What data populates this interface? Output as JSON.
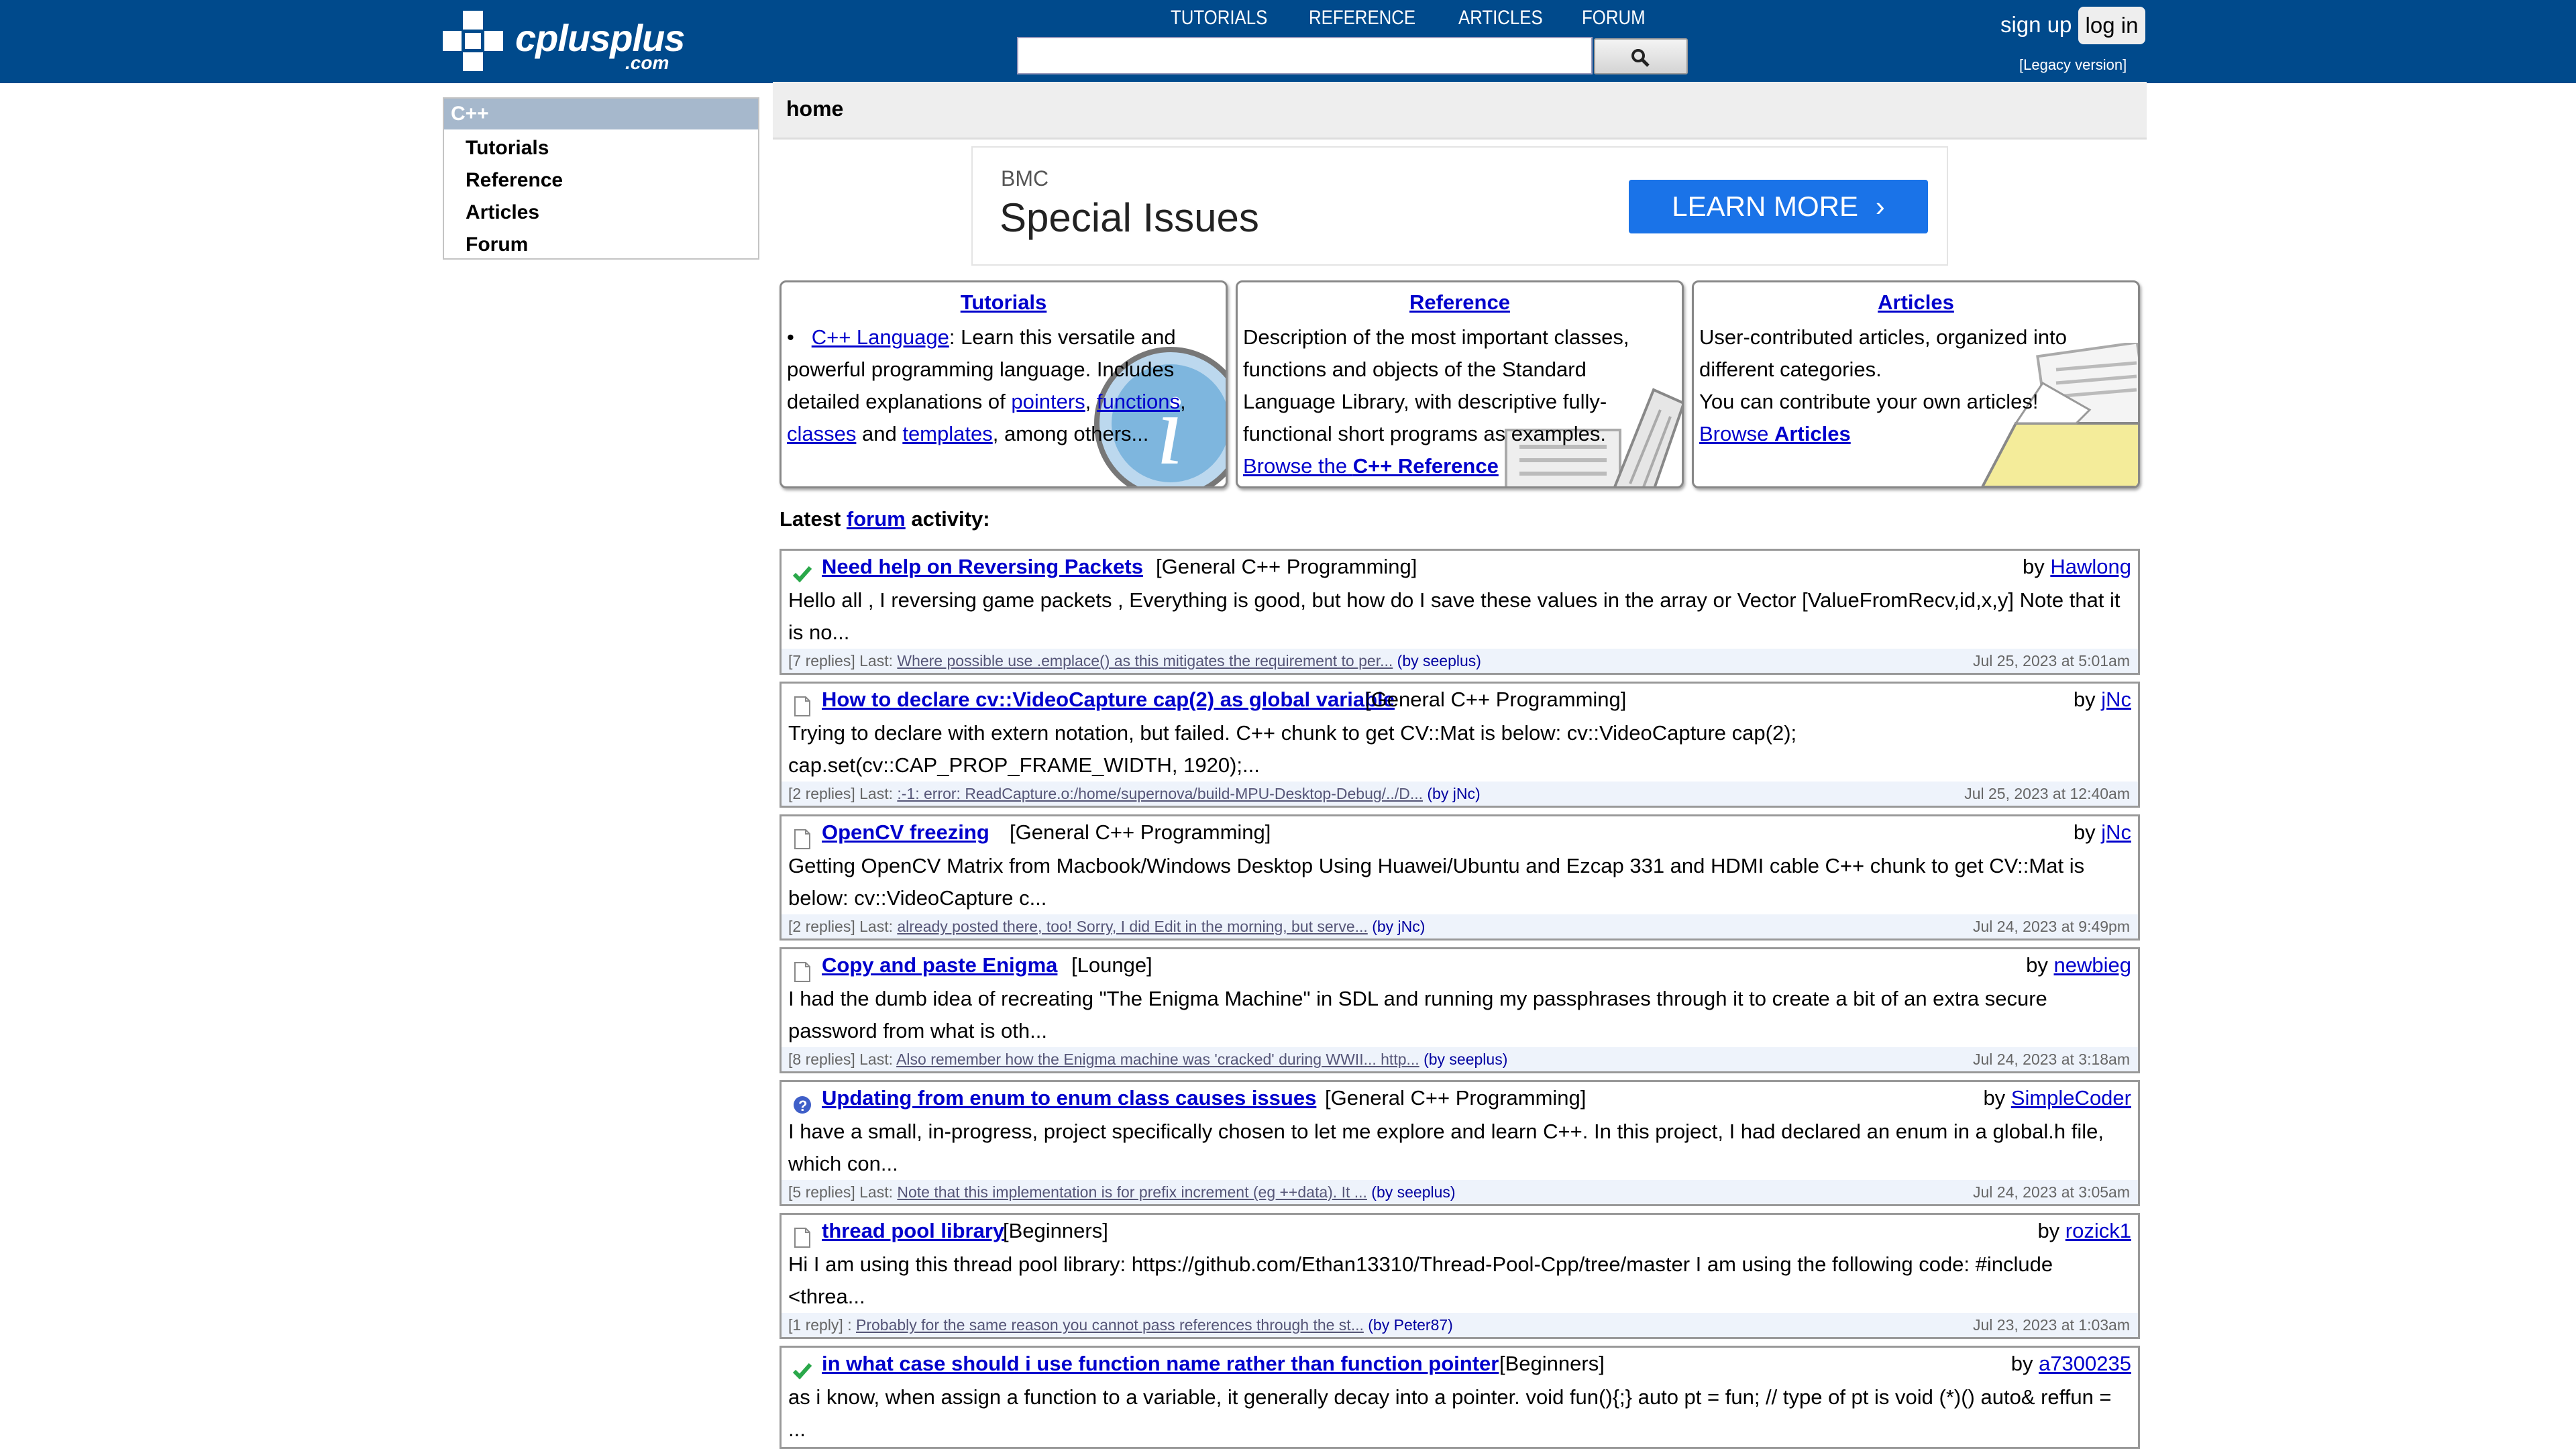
{
  "header": {
    "logo_word": "cplusplus",
    "logo_domain": ".com",
    "nav": [
      "TUTORIALS",
      "REFERENCE",
      "ARTICLES",
      "FORUM"
    ],
    "search_value": "",
    "sign_up": "sign up",
    "log_in": "log in",
    "legacy": "[Legacy version]"
  },
  "sidebar": {
    "heading": "C++",
    "items": [
      "Tutorials",
      "Reference",
      "Articles",
      "Forum"
    ]
  },
  "main": {
    "breadcrumb": "home",
    "ad": {
      "brand": "BMC",
      "headline": "Special Issues",
      "cta": "LEARN MORE"
    },
    "tutorials": {
      "title": "Tutorials",
      "bullet": "•",
      "link": "C++ Language",
      "text1": ": Learn this versatile and powerful programming language. Includes detailed explanations of ",
      "l_pointers": "pointers",
      "comma1": ", ",
      "l_functions": "functions",
      "comma2": ", ",
      "l_classes": "classes",
      "and": " and ",
      "l_templates": "templates",
      "tail": ", among others..."
    },
    "reference": {
      "title": "Reference",
      "text": "Description of the most important classes, functions and objects of the Standard Language Library, with descriptive fully-functional short programs as examples.",
      "link_prefix": "Browse the ",
      "link_bold": "C++ Reference"
    },
    "articles": {
      "title": "Articles",
      "text1": "User-contributed articles, organized into different categories.",
      "text2": "You can contribute your own articles!",
      "link_prefix": "Browse ",
      "link_bold": "Articles"
    },
    "latest": {
      "prefix": "Latest ",
      "link": "forum",
      "suffix": " activity:"
    },
    "posts": [
      {
        "icon": "check-icon",
        "title": "Need help on Reversing Packets",
        "category": "[General C++ Programming]",
        "by": "by ",
        "author": "Hawlong",
        "excerpt": "Hello all , I reversing game packets , Everything is good, but how do I save these values in the array or Vector [ValueFromRecv,id,x,y] Note that it is no...",
        "replies": "[7 replies] Last: ",
        "last": "Where possible use .emplace() as this mitigates the requirement to per...",
        "last_by": " (by seeplus)",
        "date": "Jul 25, 2023 at 5:01am"
      },
      {
        "icon": "document-icon",
        "title": "How to declare cv::VideoCapture cap(2) as global variable",
        "category": "[General C++ Programming]",
        "by": "by ",
        "author": "jNc",
        "excerpt": "Trying to declare with extern notation, but failed. C++ chunk to get CV::Mat is below: cv::VideoCapture cap(2); cap.set(cv::CAP_PROP_FRAME_WIDTH, 1920);...",
        "replies": "[2 replies] Last: ",
        "last": ":-1: error: ReadCapture.o:/home/supernova/build-MPU-Desktop-Debug/../D...",
        "last_by": " (by jNc)",
        "date": "Jul 25, 2023 at 12:40am"
      },
      {
        "icon": "document-icon",
        "title": "OpenCV freezing",
        "category": "[General C++ Programming]",
        "by": "by ",
        "author": "jNc",
        "excerpt": "Getting OpenCV Matrix from Macbook/Windows Desktop Using Huawei/Ubuntu and Ezcap 331 and HDMI cable C++ chunk to get CV::Mat is below: cv::VideoCapture c...",
        "replies": "[2 replies] Last: ",
        "last": "already posted there, too! Sorry, I did Edit in the morning, but serve...",
        "last_by": " (by jNc)",
        "date": "Jul 24, 2023 at 9:49pm"
      },
      {
        "icon": "document-icon",
        "title": "Copy and paste Enigma",
        "category": "[Lounge]",
        "by": "by ",
        "author": "newbieg",
        "excerpt": "I had the dumb idea of recreating \"The Enigma Machine\" in SDL and running my passphrases through it to create a bit of an extra secure password from what is oth...",
        "replies": "[8 replies] Last: ",
        "last": "Also remember how the Enigma machine was 'cracked' during WWII... http...",
        "last_by": " (by seeplus)",
        "date": "Jul 24, 2023 at 3:18am"
      },
      {
        "icon": "question-icon",
        "title": "Updating from enum to enum class causes issues",
        "category": "[General C++ Programming]",
        "by": "by ",
        "author": "SimpleCoder",
        "excerpt": "I have a small, in-progress, project specifically chosen to let me explore and learn C++. In this project, I had declared an enum in a global.h file, which con...",
        "replies": "[5 replies] Last: ",
        "last": "Note that this implementation is for prefix increment (eg ++data). It ...",
        "last_by": " (by seeplus)",
        "date": "Jul 24, 2023 at 3:05am"
      },
      {
        "icon": "document-icon",
        "title": "thread pool library",
        "category": "[Beginners]",
        "by": "by ",
        "author": "rozick1",
        "excerpt": "Hi I am using this thread pool library: https://github.com/Ethan13310/Thread-Pool-Cpp/tree/master I am using the following code: #include <threa...",
        "replies": "[1 reply] : ",
        "last": "Probably for the same reason you cannot pass references through the st...",
        "last_by": " (by Peter87)",
        "date": "Jul 23, 2023 at 1:03am"
      },
      {
        "icon": "check-icon",
        "title": "in what case should i use function name rather than function pointer",
        "category": "[Beginners]",
        "by": "by ",
        "author": "a7300235",
        "excerpt": "as i know, when assign a function to a variable, it generally decay into a pointer. void fun(){;} auto pt = fun; // type of pt is void (*)() auto& reffun = ...",
        "replies": "",
        "last": "",
        "last_by": "",
        "date": ""
      }
    ]
  },
  "colors": {
    "header_bg": "#004a8c",
    "link": "#0000cc",
    "sidebar_head": "#a6b8cc",
    "ad_cta": "#1a73e8",
    "meta_bg": "#eef3fb"
  }
}
